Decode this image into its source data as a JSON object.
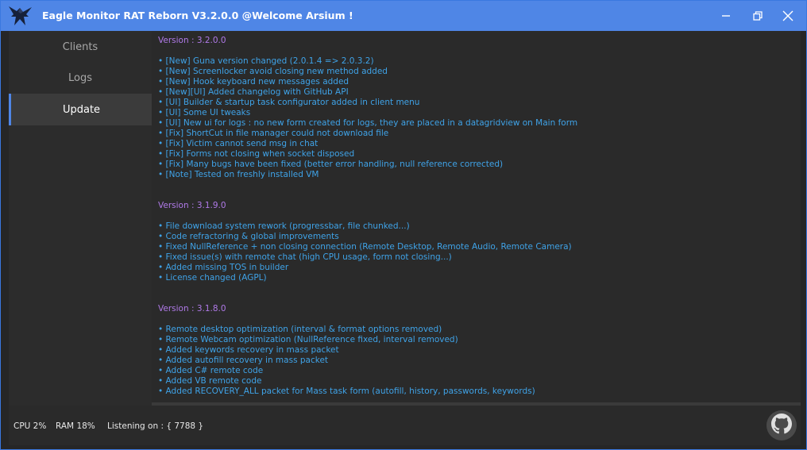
{
  "window": {
    "title": "Eagle Monitor RAT Reborn V3.2.0.0 @Welcome Arsium !"
  },
  "icons": {
    "app": "eagle-icon",
    "minimize": "minimize-icon",
    "maximize": "restore-icon",
    "close": "close-icon",
    "github": "github-icon"
  },
  "colors": {
    "titlebar": "#4f86e6",
    "version_heading": "#b07ae8",
    "changelog_text": "#3fa3e8",
    "background": "#2a2a2a"
  },
  "sidebar": {
    "items": [
      {
        "label": "Clients",
        "active": false
      },
      {
        "label": "Logs",
        "active": false
      },
      {
        "label": "Update",
        "active": true
      }
    ]
  },
  "changelog": {
    "versions": [
      {
        "heading": "Version : 3.2.0.0",
        "items": [
          "• [New] Guna version changed (2.0.1.4 => 2.0.3.2)",
          "• [New] Screenlocker avoid closing new method added",
          "• [New] Hook keyboard new messages added",
          "• [New][UI] Added changelog with GitHub API",
          "• [UI] Builder & startup task configurator added in client menu",
          "• [UI] Some UI tweaks",
          "• [UI] New ui for logs : no new form created for logs, they are placed in a datagridview on Main form",
          "• [Fix] ShortCut in file manager could not download file",
          "• [Fix] Victim cannot send msg in chat",
          "• [Fix] Forms not closing when socket disposed",
          "• [Fix] Many bugs have been fixed (better error handling, null reference corrected)",
          "• [Note] Tested on freshly installed VM"
        ]
      },
      {
        "heading": "Version : 3.1.9.0",
        "items": [
          "• File download system rework (progressbar, file chunked...)",
          "• Code refractoring & global improvements",
          "• Fixed NullReference + non closing connection (Remote Desktop, Remote Audio, Remote Camera)",
          "• Fixed issue(s) with remote chat (high CPU usage, form not closing...)",
          "• Added missing TOS in builder",
          "• License changed (AGPL)"
        ]
      },
      {
        "heading": "Version : 3.1.8.0",
        "items": [
          "• Remote desktop optimization (interval & format options removed)",
          "• Remote Webcam optimization (NullReference fixed, interval removed)",
          "• Added keywords recovery in mass packet",
          "• Added autofill recovery in mass packet",
          "• Added C# remote code",
          "• Added VB remote code",
          "• Added RECOVERY_ALL packet for Mass task form (autofill, history, passwords, keywords)"
        ]
      }
    ]
  },
  "status": {
    "cpu": "CPU 2%",
    "ram": "RAM 18%",
    "listening": "Listening on : { 7788 }"
  }
}
